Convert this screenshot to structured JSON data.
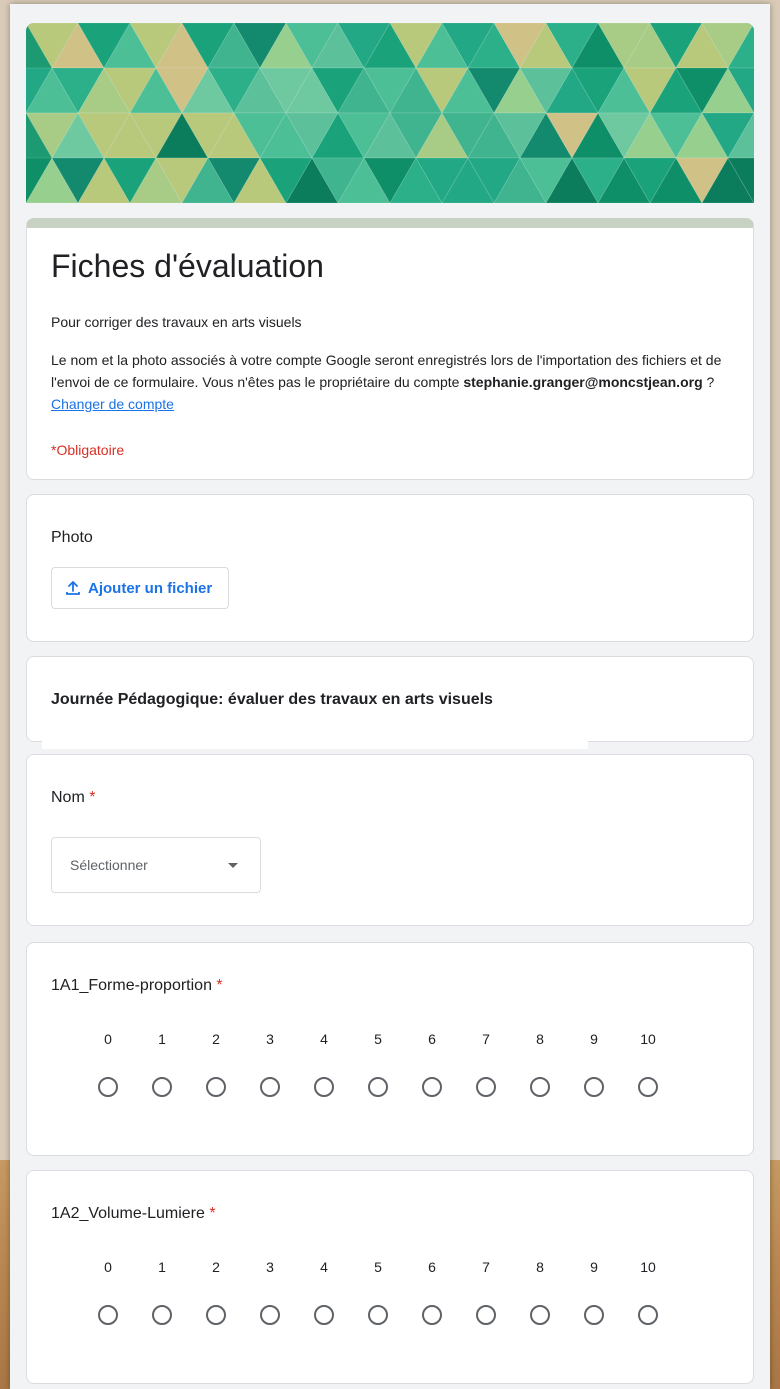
{
  "form": {
    "title": "Fiches d'évaluation",
    "description": "Pour corriger des travaux en arts visuels",
    "account_text_before": "Le nom et la photo associés à votre compte Google seront enregistrés lors de l'importation des fichiers et de l'envoi de ce formulaire. Vous n'êtes pas le propriétaire du compte ",
    "account_email": "stephanie.granger@moncstjean.org",
    "account_text_after": " ? ",
    "change_account_link": "Changer de compte",
    "required_note": "*Obligatoire"
  },
  "photo_question": {
    "title": "Photo",
    "upload_label": "Ajouter un fichier",
    "upload_icon": "upload-icon"
  },
  "section": {
    "title": "Journée Pédagogique: évaluer des travaux en arts visuels"
  },
  "name_question": {
    "title": "Nom",
    "required_mark": "*",
    "select_placeholder": "Sélectionner",
    "select_icon": "chevron-down-icon"
  },
  "scale_questions": [
    {
      "title": "1A1_Forme-proportion",
      "required_mark": "*",
      "labels": [
        "0",
        "1",
        "2",
        "3",
        "4",
        "5",
        "6",
        "7",
        "8",
        "9",
        "10"
      ]
    },
    {
      "title": "1A2_Volume-Lumiere",
      "required_mark": "*",
      "labels": [
        "0",
        "1",
        "2",
        "3",
        "4",
        "5",
        "6",
        "7",
        "8",
        "9",
        "10"
      ]
    }
  ],
  "colors": {
    "accent": "#1a73e8",
    "required": "#d93025",
    "banner_green": "#1e9a72",
    "header_bar": "#c8d2c2"
  }
}
